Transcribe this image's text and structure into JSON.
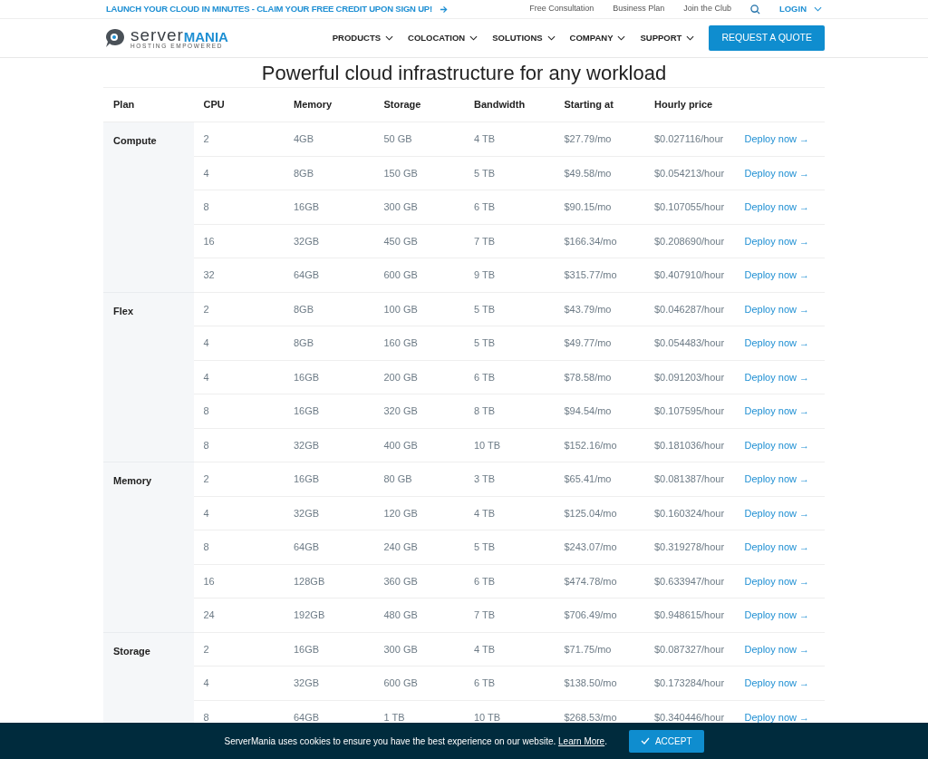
{
  "promo_bar": {
    "announcement": "LAUNCH YOUR CLOUD IN MINUTES - CLAIM YOUR FREE CREDIT UPON SIGN UP!",
    "links": [
      "Free Consultation",
      "Business Plan",
      "Join the Club"
    ],
    "login": "LOGIN"
  },
  "navbar": {
    "logo": {
      "word_1": "server",
      "word_2": "MANIA",
      "tagline": "HOSTING EMPOWERED"
    },
    "menu": [
      "PRODUCTS",
      "COLOCATION",
      "SOLUTIONS",
      "COMPANY",
      "SUPPORT"
    ],
    "cta": "REQUEST A QUOTE"
  },
  "heading": "Powerful cloud infrastructure for any workload",
  "table": {
    "columns": [
      "Plan",
      "CPU",
      "Memory",
      "Storage",
      "Bandwidth",
      "Starting at",
      "Hourly price"
    ],
    "groups": [
      {
        "plan": "Compute",
        "rows": [
          [
            "2",
            "4GB",
            "50 GB",
            "4 TB",
            "$27.79/mo",
            "$0.027116/hour",
            "Deploy now →"
          ],
          [
            "4",
            "8GB",
            "150 GB",
            "5 TB",
            "$49.58/mo",
            "$0.054213/hour",
            "Deploy now →"
          ],
          [
            "8",
            "16GB",
            "300 GB",
            "6 TB",
            "$90.15/mo",
            "$0.107055/hour",
            "Deploy now →"
          ],
          [
            "16",
            "32GB",
            "450 GB",
            "7 TB",
            "$166.34/mo",
            "$0.208690/hour",
            "Deploy now →"
          ],
          [
            "32",
            "64GB",
            "600 GB",
            "9 TB",
            "$315.77/mo",
            "$0.407910/hour",
            "Deploy now →"
          ]
        ]
      },
      {
        "plan": "Flex",
        "rows": [
          [
            "2",
            "8GB",
            "100 GB",
            "5 TB",
            "$43.79/mo",
            "$0.046287/hour",
            "Deploy now →"
          ],
          [
            "4",
            "8GB",
            "160 GB",
            "5 TB",
            "$49.77/mo",
            "$0.054483/hour",
            "Deploy now →"
          ],
          [
            "4",
            "16GB",
            "200 GB",
            "6 TB",
            "$78.58/mo",
            "$0.091203/hour",
            "Deploy now →"
          ],
          [
            "8",
            "16GB",
            "320 GB",
            "8 TB",
            "$94.54/mo",
            "$0.107595/hour",
            "Deploy now →"
          ],
          [
            "8",
            "32GB",
            "400 GB",
            "10 TB",
            "$152.16/mo",
            "$0.181036/hour",
            "Deploy now →"
          ]
        ]
      },
      {
        "plan": "Memory",
        "rows": [
          [
            "2",
            "16GB",
            "80 GB",
            "3 TB",
            "$65.41/mo",
            "$0.081387/hour",
            "Deploy now →"
          ],
          [
            "4",
            "32GB",
            "120 GB",
            "4 TB",
            "$125.04/mo",
            "$0.160324/hour",
            "Deploy now →"
          ],
          [
            "8",
            "64GB",
            "240 GB",
            "5 TB",
            "$243.07/mo",
            "$0.319278/hour",
            "Deploy now →"
          ],
          [
            "16",
            "128GB",
            "360 GB",
            "6 TB",
            "$474.78/mo",
            "$0.633947/hour",
            "Deploy now →"
          ],
          [
            "24",
            "192GB",
            "480 GB",
            "7 TB",
            "$706.49/mo",
            "$0.948615/hour",
            "Deploy now →"
          ]
        ]
      },
      {
        "plan": "Storage",
        "rows": [
          [
            "2",
            "16GB",
            "300 GB",
            "4 TB",
            "$71.75/mo",
            "$0.087327/hour",
            "Deploy now →"
          ],
          [
            "4",
            "32GB",
            "600 GB",
            "6 TB",
            "$138.50/mo",
            "$0.173284/hour",
            "Deploy now →"
          ],
          [
            "8",
            "64GB",
            "1 TB",
            "10 TB",
            "$268.53/mo",
            "$0.340446/hour",
            "Deploy now →"
          ]
        ]
      }
    ]
  },
  "cookie_bar": {
    "message": "ServerMania uses cookies to ensure you have the best experience on our website.",
    "link": "Learn More",
    "after_link": ".",
    "button": "ACCEPT"
  }
}
